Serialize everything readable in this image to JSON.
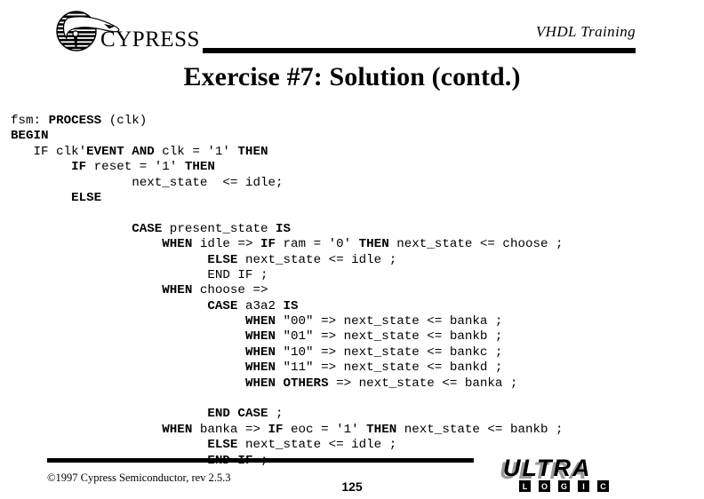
{
  "header": {
    "course_title": "VHDL Training",
    "logo_name": "cypress-logo",
    "logo_text": "CYPRESS"
  },
  "slide": {
    "title": "Exercise #7: Solution (contd.)"
  },
  "code": {
    "language": "VHDL",
    "lines": [
      [
        {
          "t": "fsm: ",
          "b": false
        },
        {
          "t": "PROCESS",
          "b": true
        },
        {
          "t": " (clk)",
          "b": false
        }
      ],
      [
        {
          "t": "BEGIN",
          "b": true
        }
      ],
      [
        {
          "t": "   IF clk'",
          "b": false
        },
        {
          "t": "EVENT AND",
          "b": true
        },
        {
          "t": " clk = '1' ",
          "b": false
        },
        {
          "t": "THEN",
          "b": true
        }
      ],
      [
        {
          "t": "        ",
          "b": false
        },
        {
          "t": "IF",
          "b": true
        },
        {
          "t": " reset = '1' ",
          "b": false
        },
        {
          "t": "THEN",
          "b": true
        }
      ],
      [
        {
          "t": "                next_state  <= idle;",
          "b": false
        }
      ],
      [
        {
          "t": "        ",
          "b": false
        },
        {
          "t": "ELSE",
          "b": true
        }
      ],
      [],
      [
        {
          "t": "                ",
          "b": false
        },
        {
          "t": "CASE",
          "b": true
        },
        {
          "t": " present_state ",
          "b": false
        },
        {
          "t": "IS",
          "b": true
        }
      ],
      [
        {
          "t": "                    ",
          "b": false
        },
        {
          "t": "WHEN",
          "b": true
        },
        {
          "t": " idle => ",
          "b": false
        },
        {
          "t": "IF",
          "b": true
        },
        {
          "t": " ram = '0' ",
          "b": false
        },
        {
          "t": "THEN",
          "b": true
        },
        {
          "t": " next_state <= choose ;",
          "b": false
        }
      ],
      [
        {
          "t": "                          ",
          "b": false
        },
        {
          "t": "ELSE",
          "b": true
        },
        {
          "t": " next_state <= idle ;",
          "b": false
        }
      ],
      [
        {
          "t": "                          END IF ;",
          "b": false
        }
      ],
      [
        {
          "t": "                    ",
          "b": false
        },
        {
          "t": "WHEN",
          "b": true
        },
        {
          "t": " choose =>",
          "b": false
        }
      ],
      [
        {
          "t": "                          ",
          "b": false
        },
        {
          "t": "CASE",
          "b": true
        },
        {
          "t": " a3a2 ",
          "b": false
        },
        {
          "t": "IS",
          "b": true
        }
      ],
      [
        {
          "t": "                               ",
          "b": false
        },
        {
          "t": "WHEN",
          "b": true
        },
        {
          "t": " \"00\" => next_state <= banka ;",
          "b": false
        }
      ],
      [
        {
          "t": "                               ",
          "b": false
        },
        {
          "t": "WHEN",
          "b": true
        },
        {
          "t": " \"01\" => next_state <= bankb ;",
          "b": false
        }
      ],
      [
        {
          "t": "                               ",
          "b": false
        },
        {
          "t": "WHEN",
          "b": true
        },
        {
          "t": " \"10\" => next_state <= bankc ;",
          "b": false
        }
      ],
      [
        {
          "t": "                               ",
          "b": false
        },
        {
          "t": "WHEN",
          "b": true
        },
        {
          "t": " \"11\" => next_state <= bankd ;",
          "b": false
        }
      ],
      [
        {
          "t": "                               ",
          "b": false
        },
        {
          "t": "WHEN OTHERS",
          "b": true
        },
        {
          "t": " => next_state <= banka ;",
          "b": false
        }
      ],
      [],
      [
        {
          "t": "                          ",
          "b": false
        },
        {
          "t": "END CASE",
          "b": true
        },
        {
          "t": " ;",
          "b": false
        }
      ],
      [
        {
          "t": "                    ",
          "b": false
        },
        {
          "t": "WHEN",
          "b": true
        },
        {
          "t": " banka => ",
          "b": false
        },
        {
          "t": "IF",
          "b": true
        },
        {
          "t": " eoc = '1' ",
          "b": false
        },
        {
          "t": "THEN",
          "b": true
        },
        {
          "t": " next_state <= bankb ;",
          "b": false
        }
      ],
      [
        {
          "t": "                          ",
          "b": false
        },
        {
          "t": "ELSE",
          "b": true
        },
        {
          "t": " next_state <= idle ;",
          "b": false
        }
      ],
      [
        {
          "t": "                          ",
          "b": false
        },
        {
          "t": "END IF",
          "b": true
        },
        {
          "t": " ;",
          "b": false
        }
      ]
    ]
  },
  "footer": {
    "copyright": "©1997 Cypress Semiconductor, rev 2.5.3",
    "page_number": "125",
    "logo_name": "ultra-logic-logo",
    "logo_word": "ULTRA",
    "logo_sub_letters": [
      "L",
      "O",
      "G",
      "I",
      "C"
    ]
  },
  "colors": {
    "background": "#ffffff",
    "text": "#000000",
    "rule": "#000000",
    "logo_shadow": "#9a9a9a"
  }
}
